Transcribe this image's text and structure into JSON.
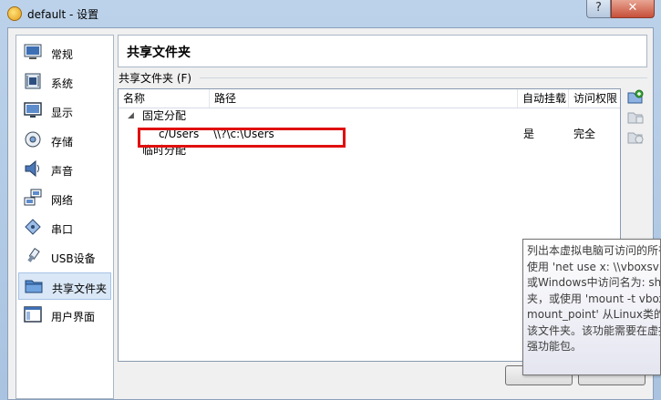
{
  "window": {
    "title": "default - 设置",
    "help_label": "?",
    "close_label": "✕"
  },
  "sidebar": {
    "items": [
      {
        "label": "常规",
        "icon": "general-icon"
      },
      {
        "label": "系统",
        "icon": "system-icon"
      },
      {
        "label": "显示",
        "icon": "display-icon"
      },
      {
        "label": "存储",
        "icon": "storage-icon"
      },
      {
        "label": "声音",
        "icon": "audio-icon"
      },
      {
        "label": "网络",
        "icon": "network-icon"
      },
      {
        "label": "串口",
        "icon": "serial-port-icon"
      },
      {
        "label": "USB设备",
        "icon": "usb-icon"
      },
      {
        "label": "共享文件夹",
        "icon": "shared-folder-icon",
        "selected": true
      },
      {
        "label": "用户界面",
        "icon": "user-interface-icon"
      }
    ]
  },
  "page": {
    "title": "共享文件夹",
    "group_label": "共享文件夹 (F)"
  },
  "table": {
    "columns": [
      "名称",
      "路径",
      "自动挂载",
      "访问权限"
    ],
    "groups": [
      {
        "label": "固定分配",
        "expanded": true,
        "rows": [
          {
            "name": "c/Users",
            "path": "\\\\?\\c:\\Users",
            "auto_mount": "是",
            "access": "完全"
          }
        ]
      },
      {
        "label": "临时分配",
        "expanded": false,
        "rows": []
      }
    ]
  },
  "toolbar": {
    "add_icon": "add-folder-icon",
    "edit_icon": "edit-folder-icon",
    "remove_icon": "remove-folder-icon"
  },
  "tooltip": {
    "lines": [
      "列出本虚拟电脑可访问的所有",
      "使用 'net use x: \\\\vboxsvr\\",
      "或Windows中访问名为: sha",
      "夹，或使用 'mount -t vbox",
      "mount_point' 从Linux类的主",
      "该文件夹。该功能需要在虚拟",
      "强功能包。"
    ]
  },
  "colors": {
    "highlight_box": "#e01010",
    "selected_bg": "#d9e7f6"
  }
}
